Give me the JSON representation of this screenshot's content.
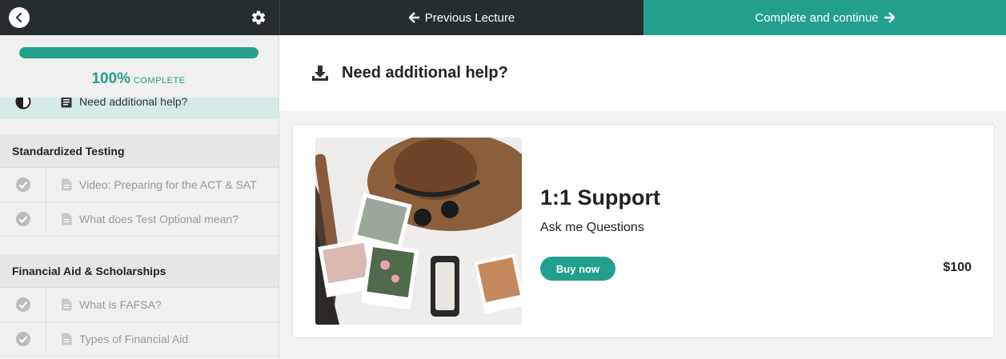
{
  "topbar": {
    "back_icon": "chevron-left-icon",
    "settings_icon": "gear-icon",
    "previous_label": "Previous Lecture",
    "next_label": "Complete and continue"
  },
  "progress": {
    "percent_text": "100%",
    "complete_label": "COMPLETE",
    "fraction": 1.0
  },
  "sidebar": {
    "active_lesson": {
      "title": "Need additional help?"
    },
    "sections": [
      {
        "title": "Standardized Testing",
        "lessons": [
          {
            "title": "Video: Preparing for the ACT & SAT"
          },
          {
            "title": "What does Test Optional mean?"
          }
        ]
      },
      {
        "title": "Financial Aid & Scholarships",
        "lessons": [
          {
            "title": "What is FAFSA?"
          },
          {
            "title": "Types of Financial Aid"
          }
        ]
      }
    ]
  },
  "lecture": {
    "icon": "download-icon",
    "title": "Need additional help?"
  },
  "product": {
    "title": "1:1 Support",
    "subtitle": "Ask me Questions",
    "buy_label": "Buy now",
    "price": "$100"
  },
  "colors": {
    "accent": "#23a08d",
    "topbar": "#262d30"
  }
}
